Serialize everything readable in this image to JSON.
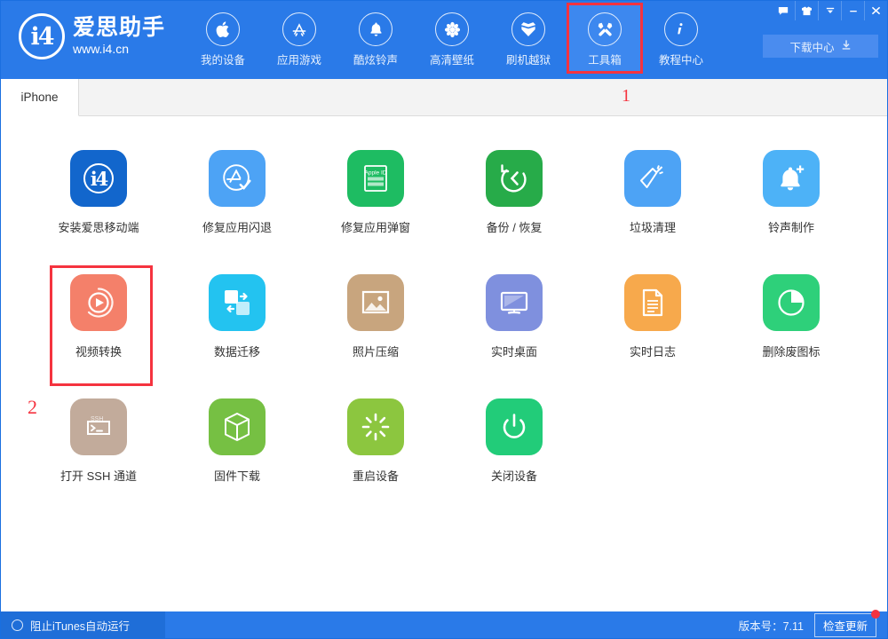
{
  "brand": {
    "logo_text": "i4",
    "logo_icon": "i4-circle-logo-icon",
    "title": "爱思助手",
    "url": "www.i4.cn"
  },
  "header": {
    "nav_items": [
      {
        "label": "我的设备",
        "icon": "apple-icon",
        "active": false,
        "annotated": false
      },
      {
        "label": "应用游戏",
        "icon": "appstore-icon",
        "active": false,
        "annotated": false
      },
      {
        "label": "酷炫铃声",
        "icon": "bell-icon",
        "active": false,
        "annotated": false
      },
      {
        "label": "高清壁纸",
        "icon": "flower-icon",
        "active": false,
        "annotated": false
      },
      {
        "label": "刷机越狱",
        "icon": "open-box-icon",
        "active": false,
        "annotated": false
      },
      {
        "label": "工具箱",
        "icon": "tools-icon",
        "active": true,
        "annotated": true
      },
      {
        "label": "教程中心",
        "icon": "info-icon",
        "active": false,
        "annotated": false
      }
    ],
    "window_controls": [
      {
        "name": "message-icon",
        "title": "消息"
      },
      {
        "name": "skin-icon",
        "title": "换肤"
      },
      {
        "name": "menu-chevron-icon",
        "title": "菜单"
      },
      {
        "name": "minimize-icon",
        "title": "最小化"
      },
      {
        "name": "close-icon",
        "title": "关闭"
      }
    ],
    "download_center": {
      "label": "下载中心",
      "icon": "download-icon"
    }
  },
  "tabs": [
    {
      "label": "iPhone",
      "active": true
    }
  ],
  "annotations": [
    {
      "id": "1",
      "target": "工具箱"
    },
    {
      "id": "2",
      "target": "视频转换"
    }
  ],
  "toolbox": {
    "tiles": [
      {
        "label": "安装爱思移动端",
        "icon": "i4-app-icon",
        "color": "#1266cc",
        "annotated": false
      },
      {
        "label": "修复应用闪退",
        "icon": "appstore-check-icon",
        "color": "#4da3f5",
        "annotated": false
      },
      {
        "label": "修复应用弹窗",
        "icon": "apple-id-card-icon",
        "color": "#1ebc62",
        "annotated": false
      },
      {
        "label": "备份 / 恢复",
        "icon": "restore-arrow-icon",
        "color": "#27ab49",
        "annotated": false
      },
      {
        "label": "垃圾清理",
        "icon": "broom-icon",
        "color": "#4da3f5",
        "annotated": false
      },
      {
        "label": "铃声制作",
        "icon": "bell-plus-icon",
        "color": "#4db2f7",
        "annotated": false
      },
      {
        "label": "视频转换",
        "icon": "video-play-icon",
        "color": "#f4806a",
        "annotated": true
      },
      {
        "label": "数据迁移",
        "icon": "data-migrate-icon",
        "color": "#23c3f0",
        "annotated": false
      },
      {
        "label": "照片压缩",
        "icon": "photo-icon",
        "color": "#c8a57e",
        "annotated": false
      },
      {
        "label": "实时桌面",
        "icon": "monitor-icon",
        "color": "#7f90de",
        "annotated": false
      },
      {
        "label": "实时日志",
        "icon": "document-icon",
        "color": "#f7a94c",
        "annotated": false
      },
      {
        "label": "删除废图标",
        "icon": "pie-circle-icon",
        "color": "#2ed07a",
        "annotated": false
      },
      {
        "label": "打开 SSH 通道",
        "icon": "ssh-terminal-icon",
        "color": "#c2ab9b",
        "annotated": false
      },
      {
        "label": "固件下载",
        "icon": "cube-icon",
        "color": "#76c043",
        "annotated": false
      },
      {
        "label": "重启设备",
        "icon": "restart-icon",
        "color": "#8cc63f",
        "annotated": false
      },
      {
        "label": "关闭设备",
        "icon": "power-icon",
        "color": "#22cc79",
        "annotated": false
      }
    ]
  },
  "statusbar": {
    "block_itunes_label": "阻止iTunes自动运行",
    "block_itunes_toggle": "toggle-off-icon",
    "version_text": "版本号：7.11",
    "update_button_label": "检查更新",
    "update_has_notification": true
  },
  "colors": {
    "brand_blue": "#2a7ae8",
    "active_nav_blue": "#3d88ef",
    "annotation_red": "#f5333f",
    "status_bar_blue": "#2a7ae8"
  }
}
